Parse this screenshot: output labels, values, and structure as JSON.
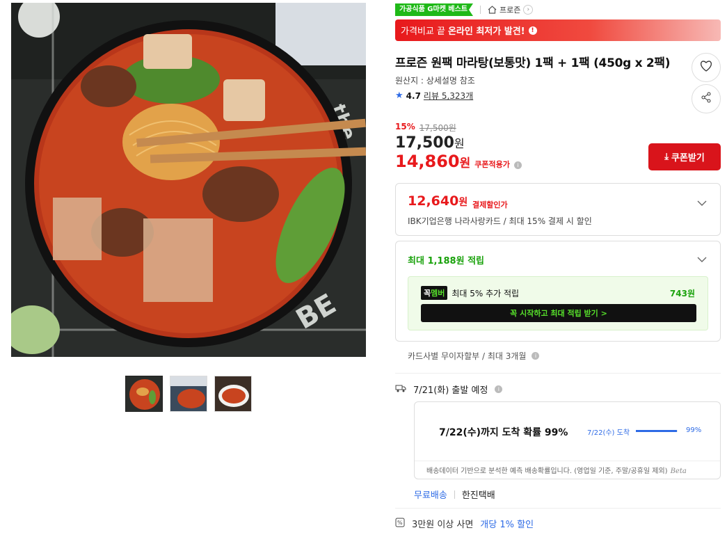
{
  "product": {
    "badge": "가공식품 G마켓 베스트",
    "store": "프로즌",
    "promo_text": "가격비교 끝",
    "promo_strong": "온라인 최저가 발견!",
    "title": "프로즌 원팩 마라탕(보통맛) 1팩 + 1팩 (450g x 2팩)",
    "origin": "원산지 : 상세설명 참조",
    "rating": "4.7",
    "reviews": "리뷰 5,323개"
  },
  "price": {
    "discount_rate": "15%",
    "original": "17,500원",
    "sale_number": "17,500",
    "sale_unit": "원",
    "coupon_number": "14,860",
    "coupon_unit": "원",
    "coupon_label": "쿠폰적용가",
    "coupon_button": "쿠폰받기"
  },
  "payment": {
    "number": "12,640",
    "unit": "원",
    "label": "결제할인가",
    "desc": "IBK기업은행 나라사랑카드 / 최대 15% 결제 시 할인"
  },
  "points": {
    "prefix": "최대 ",
    "amount": "1,188원",
    "suffix": " 적립",
    "member_badge_a": "꼭",
    "member_badge_b": "멤버",
    "member_text": "최대 5% 추가 적립",
    "member_points": "743원",
    "member_button": "꼭 시작하고 최대 적립 받기 >"
  },
  "installment": "카드사별 무이자할부 / 최대 3개월",
  "delivery": {
    "ship_date": "7/21(화) 출발 예정",
    "arrival_main": "7/22(수)까지 도착 확률 99%",
    "arrival_date": "7/22(수) 도착",
    "arrival_fill": 0.99,
    "arrival_pct": "99%",
    "note": "배송데이터 기반으로 분석한 예측 배송확률입니다. (영업일 기준, 주말/공휴일 제외)",
    "beta": "Beta",
    "free_ship": "무료배송",
    "courier": "한진택배"
  },
  "bulk": {
    "text": "3만원 이상 사면",
    "highlight": "개당 1% 할인"
  },
  "colors": {
    "accent_red": "#e8191c",
    "accent_blue": "#2e6be6",
    "accent_green": "#1aa20c"
  }
}
